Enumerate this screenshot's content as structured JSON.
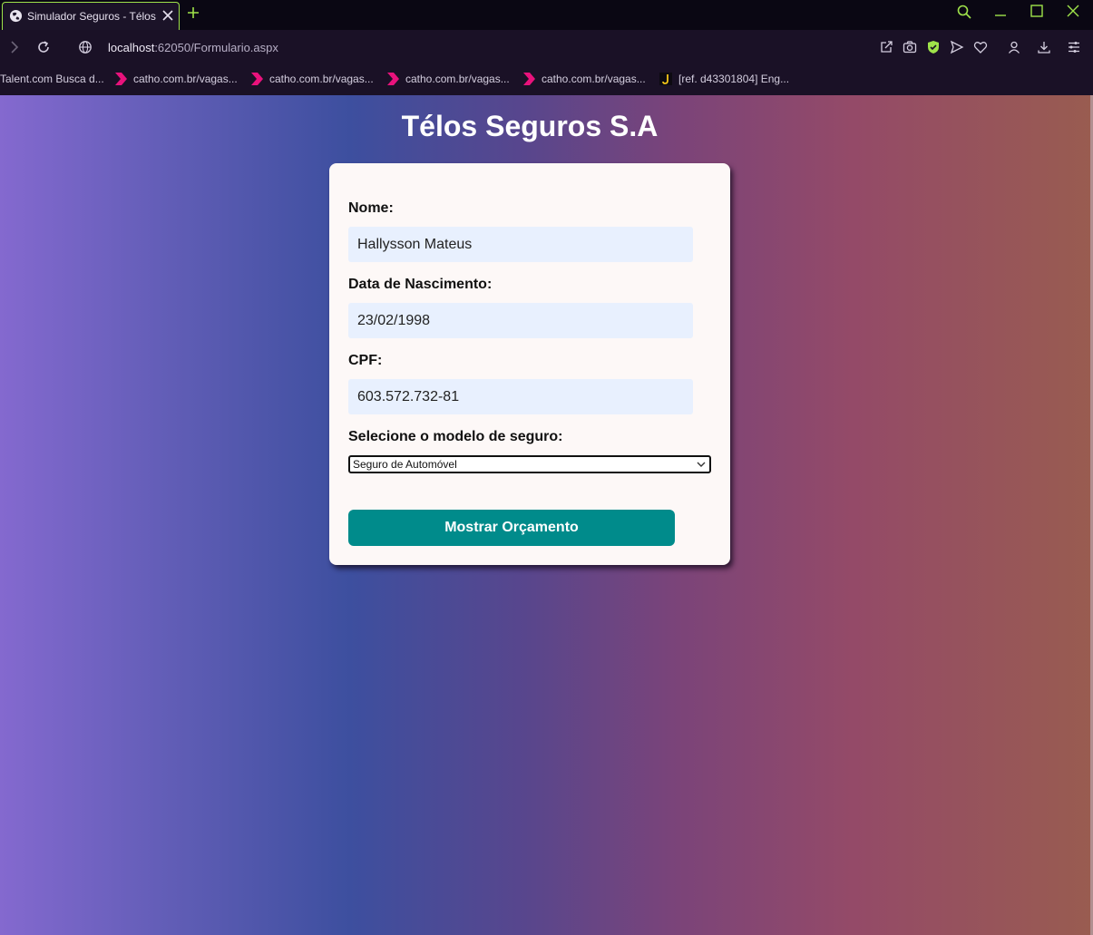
{
  "browser": {
    "tab_title": "Simulador Seguros - Télos",
    "url_host": "localhost",
    "url_rest": ":62050/Formulario.aspx",
    "accent_color": "#9fe34a",
    "bookmarks": [
      {
        "label": "Talent.com Busca d...",
        "icon": "talent-icon"
      },
      {
        "label": "catho.com.br/vagas...",
        "icon": "catho-icon"
      },
      {
        "label": "catho.com.br/vagas...",
        "icon": "catho-icon"
      },
      {
        "label": "catho.com.br/vagas...",
        "icon": "catho-icon"
      },
      {
        "label": "catho.com.br/vagas...",
        "icon": "catho-icon"
      },
      {
        "label": "[ref. d43301804] Eng...",
        "icon": "jira-icon"
      }
    ]
  },
  "page": {
    "title": "Télos Seguros S.A",
    "form": {
      "nome_label": "Nome:",
      "nome_value": "Hallysson Mateus",
      "nascimento_label": "Data de Nascimento:",
      "nascimento_value": "23/02/1998",
      "cpf_label": "CPF:",
      "cpf_value": "603.572.732-81",
      "modelo_label": "Selecione o modelo de seguro:",
      "modelo_selected": "Seguro de Automóvel",
      "submit_label": "Mostrar Orçamento"
    },
    "button_color": "#008b8b",
    "card_color": "#fdf8f7"
  }
}
